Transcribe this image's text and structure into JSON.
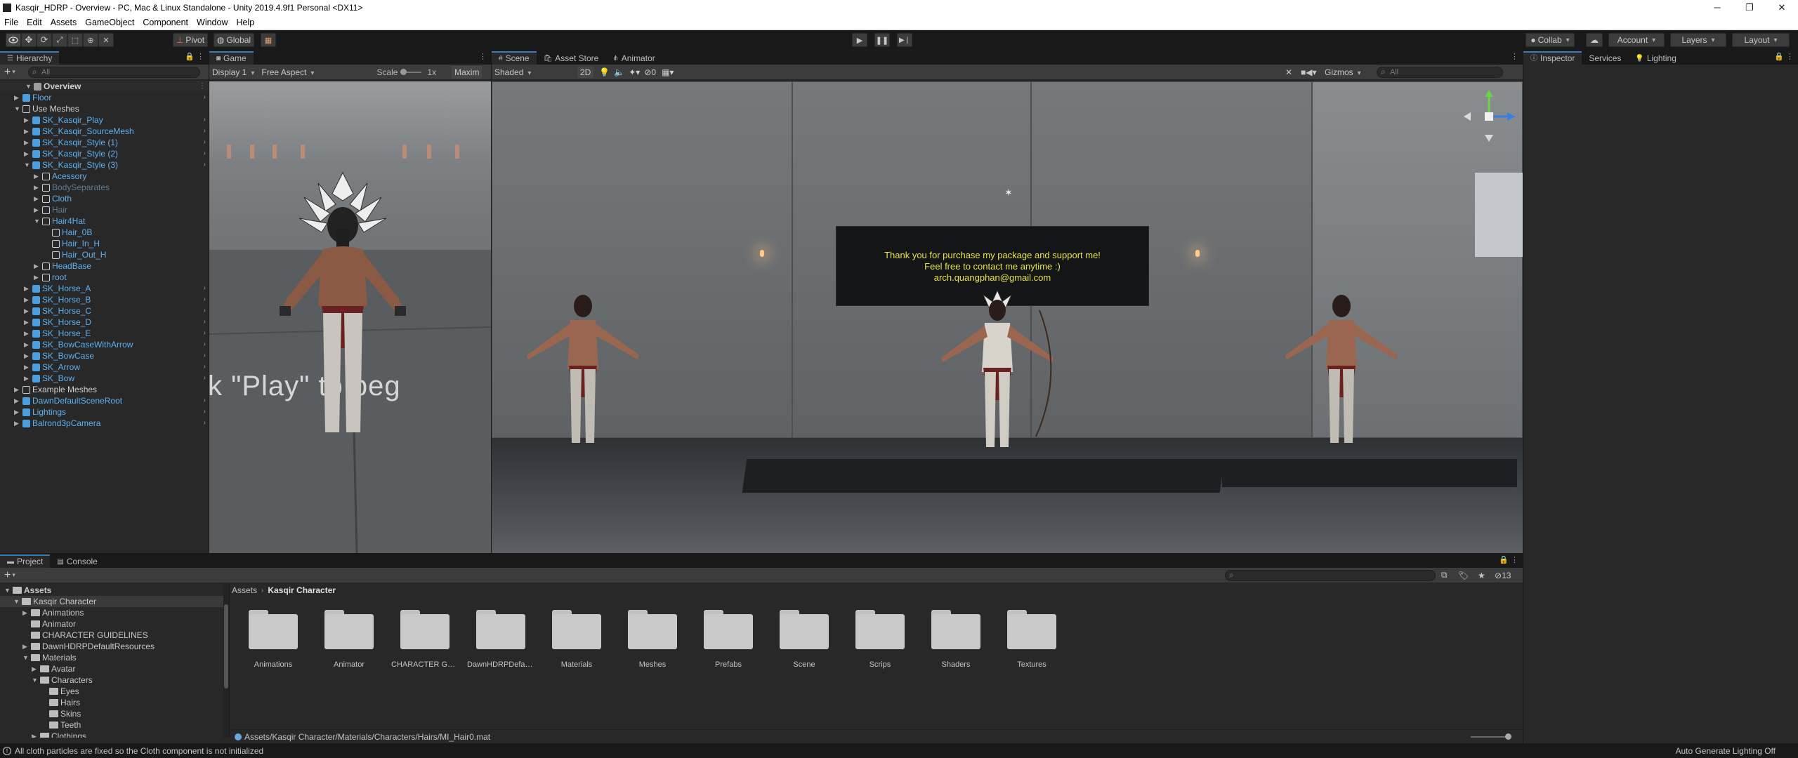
{
  "window": {
    "title": "Kasqir_HDRP - Overview - PC, Mac & Linux Standalone - Unity 2019.4.9f1 Personal <DX11>",
    "minimize": "─",
    "maximize": "❐",
    "close": "✕"
  },
  "menu": [
    "File",
    "Edit",
    "Assets",
    "GameObject",
    "Component",
    "Window",
    "Help"
  ],
  "toolbar": {
    "pivot": "Pivot",
    "global": "Global",
    "collab": "Collab",
    "account": "Account",
    "layers": "Layers",
    "layout": "Layout"
  },
  "hierarchy": {
    "tab": "Hierarchy",
    "add": "+",
    "search_placeholder": "All",
    "rows": [
      {
        "label": "Overview",
        "depth": 0,
        "arrow": "▼",
        "icon": "unity",
        "style": "white",
        "bold": true
      },
      {
        "label": "Floor",
        "depth": 1,
        "arrow": "▶",
        "icon": "blue",
        "style": "blue",
        "more": "›"
      },
      {
        "label": "Use Meshes",
        "depth": 1,
        "arrow": "▼",
        "icon": "white",
        "style": "white"
      },
      {
        "label": "SK_Kasqir_Play",
        "depth": 2,
        "arrow": "▶",
        "icon": "blue",
        "style": "blue",
        "more": "›"
      },
      {
        "label": "SK_Kasqir_SourceMesh",
        "depth": 2,
        "arrow": "▶",
        "icon": "blue",
        "style": "blue",
        "more": "›"
      },
      {
        "label": "SK_Kasqir_Style (1)",
        "depth": 2,
        "arrow": "▶",
        "icon": "blue",
        "style": "blue",
        "more": "›"
      },
      {
        "label": "SK_Kasqir_Style (2)",
        "depth": 2,
        "arrow": "▶",
        "icon": "blue",
        "style": "blue",
        "more": "›"
      },
      {
        "label": "SK_Kasqir_Style (3)",
        "depth": 2,
        "arrow": "▼",
        "icon": "blue",
        "style": "blue",
        "more": "›"
      },
      {
        "label": "Acessory",
        "depth": 3,
        "arrow": "▶",
        "icon": "white",
        "style": "blue"
      },
      {
        "label": "BodySeparates",
        "depth": 3,
        "arrow": "▶",
        "icon": "white",
        "style": "dim"
      },
      {
        "label": "Cloth",
        "depth": 3,
        "arrow": "▶",
        "icon": "white",
        "style": "blue"
      },
      {
        "label": "Hair",
        "depth": 3,
        "arrow": "▶",
        "icon": "white",
        "style": "dim"
      },
      {
        "label": "Hair4Hat",
        "depth": 3,
        "arrow": "▼",
        "icon": "white",
        "style": "blue"
      },
      {
        "label": "Hair_0B",
        "depth": 4,
        "arrow": "",
        "icon": "white",
        "style": "blue"
      },
      {
        "label": "Hair_In_H",
        "depth": 4,
        "arrow": "",
        "icon": "white",
        "style": "blue"
      },
      {
        "label": "Hair_Out_H",
        "depth": 4,
        "arrow": "",
        "icon": "white",
        "style": "blue"
      },
      {
        "label": "HeadBase",
        "depth": 3,
        "arrow": "▶",
        "icon": "white",
        "style": "blue"
      },
      {
        "label": "root",
        "depth": 3,
        "arrow": "▶",
        "icon": "white",
        "style": "blue"
      },
      {
        "label": "SK_Horse_A",
        "depth": 2,
        "arrow": "▶",
        "icon": "blue",
        "style": "blue",
        "more": "›"
      },
      {
        "label": "SK_Horse_B",
        "depth": 2,
        "arrow": "▶",
        "icon": "blue",
        "style": "blue",
        "more": "›"
      },
      {
        "label": "SK_Horse_C",
        "depth": 2,
        "arrow": "▶",
        "icon": "blue",
        "style": "blue",
        "more": "›"
      },
      {
        "label": "SK_Horse_D",
        "depth": 2,
        "arrow": "▶",
        "icon": "blue",
        "style": "blue",
        "more": "›"
      },
      {
        "label": "SK_Horse_E",
        "depth": 2,
        "arrow": "▶",
        "icon": "blue",
        "style": "blue",
        "more": "›"
      },
      {
        "label": "SK_BowCaseWithArrow",
        "depth": 2,
        "arrow": "▶",
        "icon": "blue",
        "style": "blue",
        "more": "›"
      },
      {
        "label": "SK_BowCase",
        "depth": 2,
        "arrow": "▶",
        "icon": "blue",
        "style": "blue",
        "more": "›"
      },
      {
        "label": "SK_Arrow",
        "depth": 2,
        "arrow": "▶",
        "icon": "blue",
        "style": "blue",
        "more": "›"
      },
      {
        "label": "SK_Bow",
        "depth": 2,
        "arrow": "▶",
        "icon": "blue",
        "style": "blue",
        "more": "›"
      },
      {
        "label": "Example Meshes",
        "depth": 1,
        "arrow": "▶",
        "icon": "white",
        "style": "white"
      },
      {
        "label": "DawnDefaultSceneRoot",
        "depth": 1,
        "arrow": "▶",
        "icon": "blue",
        "style": "blue",
        "more": "›"
      },
      {
        "label": "Lightings",
        "depth": 1,
        "arrow": "▶",
        "icon": "blue",
        "style": "blue",
        "more": "›"
      },
      {
        "label": "Balrond3pCamera",
        "depth": 1,
        "arrow": "▶",
        "icon": "blue",
        "style": "blue",
        "more": "›"
      }
    ]
  },
  "game": {
    "tab": "Game",
    "display": "Display 1",
    "aspect": "Free Aspect",
    "scale_label": "Scale",
    "scale_value": "1x",
    "maximize": "Maxim",
    "overlay_text": "k \"Play\" to beg"
  },
  "scene": {
    "tabs": [
      "Scene",
      "Asset Store",
      "Animator"
    ],
    "shading": "Shaded",
    "mode_2d": "2D",
    "fx_count": "0",
    "gizmos": "Gizmos",
    "search_placeholder": "All",
    "sign_lines": [
      "Thank you for purchase my package and support me!",
      "Feel free to contact me anytime :)",
      "arch.quangphan@gmail.com"
    ],
    "colors": {
      "sign_text": "#e9e24a"
    }
  },
  "inspector": {
    "tabs": [
      "Inspector",
      "Services",
      "Lighting"
    ]
  },
  "project": {
    "tabs": [
      "Project",
      "Console"
    ],
    "add": "+",
    "hidden_count": "13",
    "tree": [
      {
        "label": "Assets",
        "depth": 0,
        "arrow": "▼",
        "bold": true
      },
      {
        "label": "Kasqir Character",
        "depth": 1,
        "arrow": "▼",
        "selected": true
      },
      {
        "label": "Animations",
        "depth": 2,
        "arrow": "▶"
      },
      {
        "label": "Animator",
        "depth": 2,
        "arrow": ""
      },
      {
        "label": "CHARACTER GUIDELINES",
        "depth": 2,
        "arrow": ""
      },
      {
        "label": "DawnHDRPDefaultResources",
        "depth": 2,
        "arrow": "▶"
      },
      {
        "label": "Materials",
        "depth": 2,
        "arrow": "▼"
      },
      {
        "label": "Avatar",
        "depth": 3,
        "arrow": "▶"
      },
      {
        "label": "Characters",
        "depth": 3,
        "arrow": "▼"
      },
      {
        "label": "Eyes",
        "depth": 4,
        "arrow": ""
      },
      {
        "label": "Hairs",
        "depth": 4,
        "arrow": ""
      },
      {
        "label": "Skins",
        "depth": 4,
        "arrow": ""
      },
      {
        "label": "Teeth",
        "depth": 4,
        "arrow": ""
      },
      {
        "label": "Clothings",
        "depth": 3,
        "arrow": "▶"
      }
    ],
    "breadcrumb": [
      "Assets",
      "Kasqir Character"
    ],
    "folders": [
      "Animations",
      "Animator",
      "CHARACTER GUI...",
      "DawnHDRPDefaul...",
      "Materials",
      "Meshes",
      "Prefabs",
      "Scene",
      "Scrips",
      "Shaders",
      "Textures"
    ],
    "selected_path": "Assets/Kasqir Character/Materials/Characters/Hairs/MI_Hair0.mat"
  },
  "status": {
    "message": "All cloth particles are fixed so the Cloth component is not initialized",
    "right": "Auto Generate Lighting Off"
  }
}
